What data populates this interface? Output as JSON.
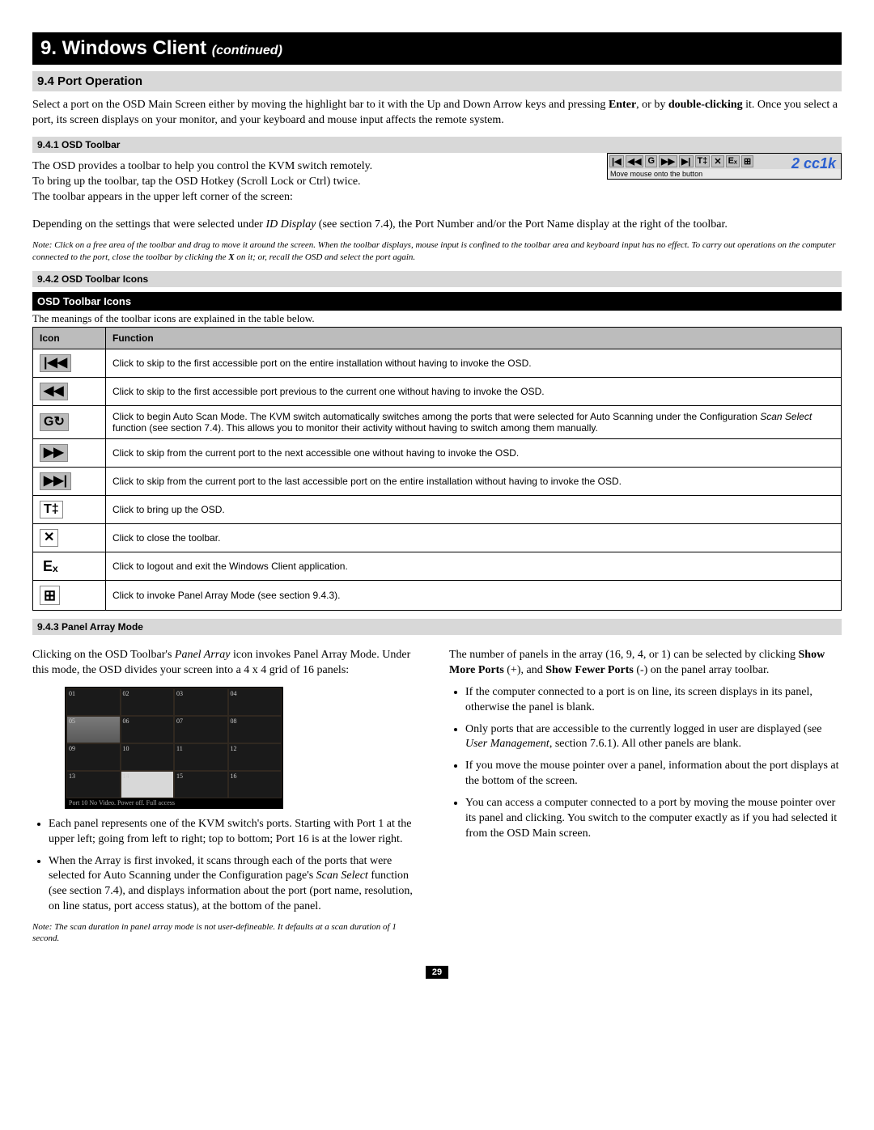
{
  "header": {
    "title": "9. Windows Client",
    "continued": "(continued)"
  },
  "section94": {
    "title": "9.4 Port Operation",
    "para_a": "Select a port on the OSD Main Screen either by moving the highlight bar to it with the Up and Down Arrow keys and pressing ",
    "enter": "Enter",
    "para_b": ", or by ",
    "double": "double-clicking",
    "para_c": " it. Once you select a port, its screen displays on your monitor, and your keyboard and mouse input affects the remote system."
  },
  "sub941": {
    "title": "9.4.1 OSD Toolbar",
    "line1": "The OSD provides a toolbar to help you control the KVM switch remotely.",
    "line2": "To bring up the toolbar, tap the OSD Hotkey (Scroll Lock or Ctrl) twice.",
    "line3": "The toolbar appears in the upper left corner of the screen:",
    "toolbar_hint": "Move mouse onto the button",
    "toolbar_port": "2 cc1k",
    "after_a": "Depending on the settings that were selected under ",
    "id_display": "ID Display",
    "after_b": " (see section 7.4), the Port Number and/or the Port Name display at the right of the toolbar.",
    "note_a": "Note: Click on a free area of the toolbar and drag to move it around the screen. When the toolbar displays, mouse input is confined to the toolbar area and keyboard input has no effect. To carry out operations on the computer connected to the port, close the toolbar by clicking the ",
    "note_x": "X",
    "note_b": " on it; or, recall the OSD and select the port again."
  },
  "sub942": {
    "title": "9.4.2 OSD Toolbar Icons",
    "black_title": "OSD Toolbar Icons",
    "intro": "The meanings of the toolbar icons are explained in the table below.",
    "th_icon": "Icon",
    "th_func": "Function",
    "rows": [
      {
        "glyph": "|◀◀",
        "name": "skip-first-icon",
        "func": "Click to skip to the first accessible port on the entire installation without having to invoke the OSD."
      },
      {
        "glyph": "◀◀",
        "name": "skip-prev-icon",
        "func": "Click to skip to the first accessible port previous to the current one without having to invoke the OSD."
      },
      {
        "glyph": "G↻",
        "name": "autoscan-icon",
        "func_a": "Click to begin Auto Scan Mode. The KVM switch automatically switches among the ports that were selected for Auto Scanning under the Configuration ",
        "scan_select": "Scan Select",
        "func_b": " function (see section 7.4). This allows you to monitor their activity without having to switch among them manually."
      },
      {
        "glyph": "▶▶",
        "name": "skip-next-icon",
        "func": "Click to skip from the current port to the next accessible one without having to invoke the OSD."
      },
      {
        "glyph": "▶▶|",
        "name": "skip-last-icon",
        "func": "Click to skip from the current port to the last accessible port on the entire installation without having to invoke the OSD."
      },
      {
        "glyph": "T‡",
        "name": "osd-icon",
        "func": "Click to bring up the OSD."
      },
      {
        "glyph": "✕",
        "name": "close-icon",
        "func": "Click to close the toolbar."
      },
      {
        "glyph": "Eₓ",
        "name": "exit-icon",
        "func": "Click to logout and exit the Windows Client application."
      },
      {
        "glyph": "⊞",
        "name": "panel-array-icon",
        "func": "Click to invoke Panel Array Mode (see section 9.4.3)."
      }
    ]
  },
  "sub943": {
    "title": "9.4.3 Panel Array Mode",
    "left_intro_a": "Clicking on the OSD Toolbar's ",
    "panel_array": "Panel Array",
    "left_intro_b": " icon invokes Panel Array Mode. Under this mode, the OSD divides your screen into a 4 x 4 grid of 16 panels:",
    "grid_status": "Port 10    No Video. Power off. Full access",
    "left_bullets": [
      "Each panel represents one of the KVM switch's ports. Starting with Port 1 at the upper left; going from left to right; top to bottom; Port 16 is at the lower right.",
      "When the Array is first invoked, it scans through each of the ports that were selected for Auto Scanning under the Configuration page's <em>Scan Select</em> function (see section 7.4), and displays information about the port (port name, resolution, on line status, port access status), at the bottom of the panel."
    ],
    "left_note": "Note: The scan duration in panel array mode is not user-defineable. It defaults at a scan duration of 1 second.",
    "right_intro_a": "The number of panels in the array (16, 9, 4, or 1) can be selected by clicking ",
    "show_more": "Show More Ports",
    "right_intro_b": " (+), and ",
    "show_fewer": "Show Fewer Ports",
    "right_intro_c": " (-) on the panel array toolbar.",
    "right_bullets": [
      "If the computer connected to a port is on line, its screen displays in its panel, otherwise the panel is blank.",
      "Only ports that are accessible to the currently logged in user are displayed (see <em>User Management</em>, section 7.6.1). All other panels are blank.",
      "If you move the mouse pointer over a panel, information about the port displays at the bottom of the screen.",
      "You can access a computer connected to a port by moving the mouse pointer over its panel and clicking. You switch to the computer exactly as if you had selected it from the OSD Main screen."
    ]
  },
  "page_number": "29"
}
